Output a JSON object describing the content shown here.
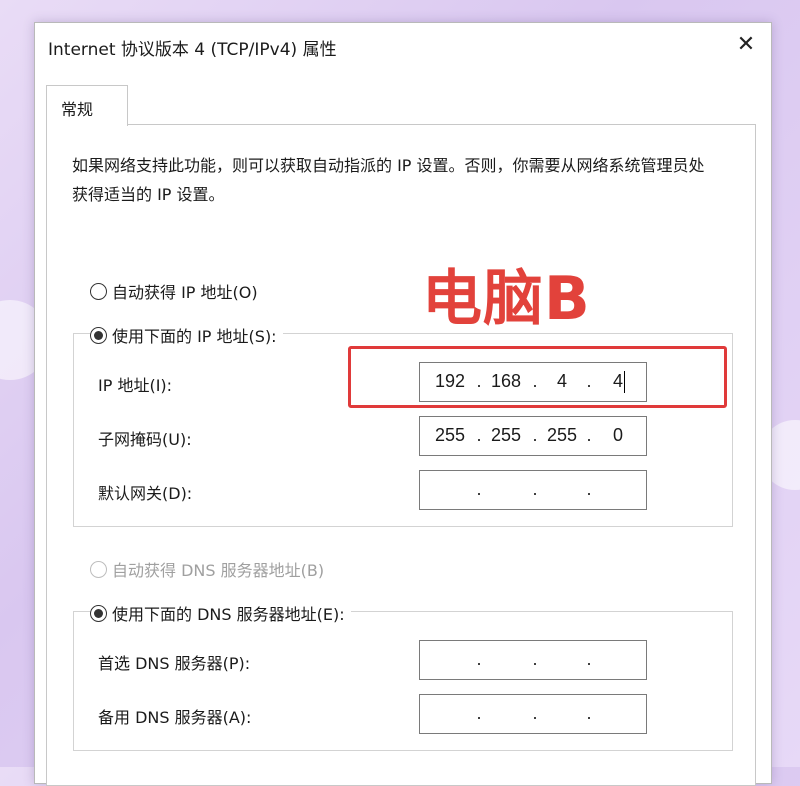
{
  "window": {
    "title": "Internet 协议版本 4 (TCP/IPv4) 属性",
    "close_glyph": "✕"
  },
  "tab": {
    "label": "常规"
  },
  "description": "如果网络支持此功能，则可以获取自动指派的 IP 设置。否则，你需要从网络系统管理员处获得适当的 IP 设置。",
  "ip_section": {
    "auto_label": "自动获得 IP 地址(O)",
    "manual_label": "使用下面的 IP 地址(S):",
    "auto_selected": false,
    "manual_selected": true,
    "fields": [
      {
        "label": "IP 地址(I):",
        "octets": [
          "192",
          "168",
          "4",
          "4"
        ]
      },
      {
        "label": "子网掩码(U):",
        "octets": [
          "255",
          "255",
          "255",
          "0"
        ]
      },
      {
        "label": "默认网关(D):",
        "octets": [
          "",
          "",
          "",
          ""
        ]
      }
    ]
  },
  "dns_section": {
    "auto_label": "自动获得 DNS 服务器地址(B)",
    "manual_label": "使用下面的 DNS 服务器地址(E):",
    "auto_enabled": false,
    "manual_selected": true,
    "fields": [
      {
        "label": "首选 DNS 服务器(P):",
        "octets": [
          "",
          "",
          "",
          ""
        ]
      },
      {
        "label": "备用 DNS 服务器(A):",
        "octets": [
          "",
          "",
          "",
          ""
        ]
      }
    ]
  },
  "annotation": {
    "text": "电脑B",
    "color": "#e2423b"
  },
  "icons": {
    "close": "close-icon"
  }
}
